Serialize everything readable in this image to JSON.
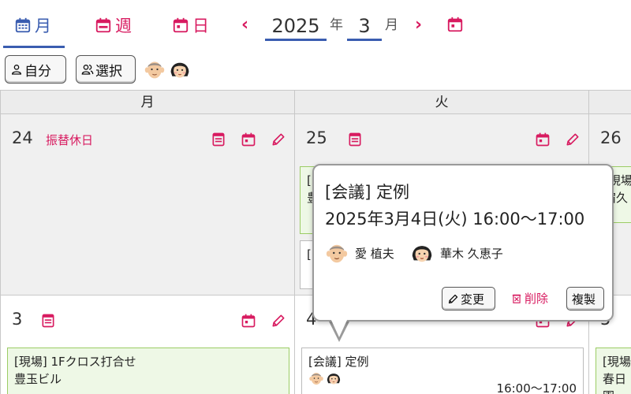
{
  "toolbar": {
    "tab_month": "月",
    "tab_week": "週",
    "tab_day": "日",
    "prev": "‹",
    "next": "›",
    "year": "2025",
    "year_unit": "年",
    "month": "3",
    "month_unit": "月"
  },
  "filters": {
    "self_label": "自分",
    "select_label": "選択"
  },
  "grid": {
    "headers": [
      "月",
      "火"
    ],
    "days": {
      "d24": "24",
      "d25": "25",
      "d26": "26",
      "d3": "3",
      "d4": "4",
      "d5": "5"
    },
    "holiday_24": "振替休日"
  },
  "events": {
    "e25_top_a": "[",
    "e25_top_b": "豊",
    "e25_mid_a": "[",
    "e26_a": "[現場",
    "e26_b": "宿久",
    "e3_title": "[現場] 1Fクロス打合せ",
    "e3_place": "豊玉ビル",
    "e4_title": "[会議] 定例",
    "e4_time": "16:00〜17:00",
    "e5_a": "[現場",
    "e5_b": "春日園"
  },
  "popover": {
    "title": "[会議] 定例",
    "datetime": "2025年3月4日(火) 16:00〜17:00",
    "members": [
      "愛 植夫",
      "華木 久恵子"
    ],
    "edit_label": "変更",
    "delete_label": "削除",
    "copy_label": "複製"
  },
  "colors": {
    "accent": "#d81b60",
    "active_tab": "#3a5db0",
    "event_border": "#9ccc65",
    "event_bg": "#eef8e6"
  }
}
